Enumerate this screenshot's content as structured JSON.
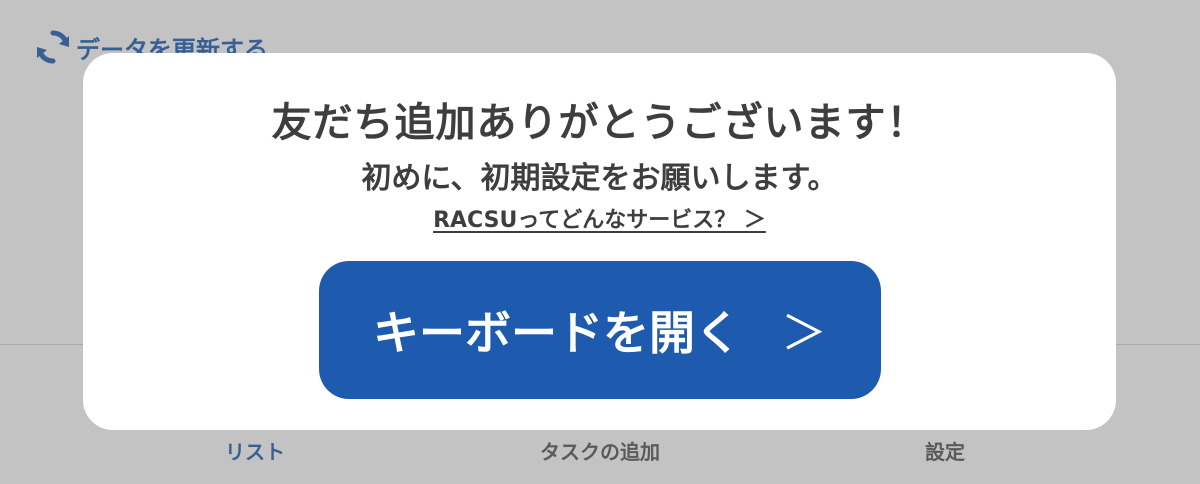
{
  "header": {
    "refresh_label": "データを更新する"
  },
  "tabbar": {
    "list_label": "リスト",
    "add_task_label": "タスクの追加",
    "settings_label": "設定"
  },
  "modal": {
    "title": "友だち追加ありがとうございます！",
    "subtitle": "初めに、初期設定をお願いします。",
    "link_label": "RACSUってどんなサービス？ ＞",
    "button_label": "キーボードを開く",
    "button_chevron": "＞"
  },
  "colors": {
    "overlay_bg": "#c3c3c3",
    "accent": "#3a5f95",
    "button_bg": "#1e5aad",
    "modal_bg": "#ffffff",
    "text_dark": "#3e3e3e"
  },
  "icons": {
    "refresh": "refresh-icon"
  }
}
